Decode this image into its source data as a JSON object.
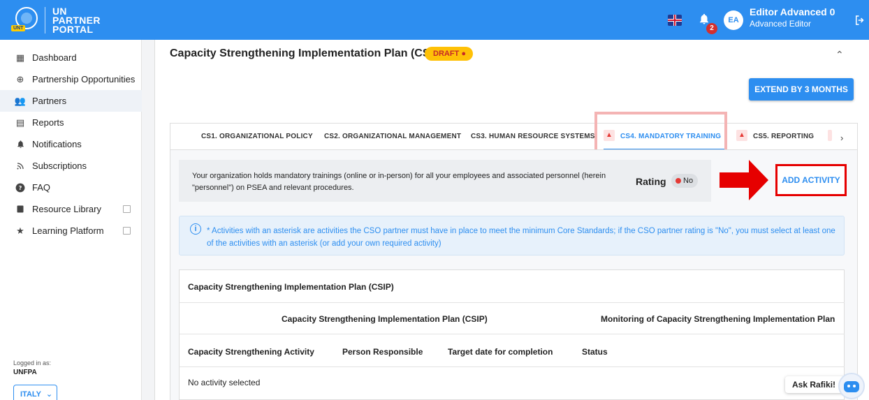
{
  "header": {
    "logo_lines": [
      "UN",
      "PARTNER",
      "PORTAL"
    ],
    "logo_tag": "UNT",
    "notification_count": "2",
    "avatar_initials": "EA",
    "user_name": "Editor Advanced 0",
    "user_role": "Advanced Editor"
  },
  "sidebar": {
    "items": [
      {
        "label": "Dashboard",
        "icon": "dashboard-icon"
      },
      {
        "label": "Partnership Opportunities",
        "icon": "globe-icon"
      },
      {
        "label": "Partners",
        "icon": "people-icon"
      },
      {
        "label": "Reports",
        "icon": "report-icon"
      },
      {
        "label": "Notifications",
        "icon": "bell-icon"
      },
      {
        "label": "Subscriptions",
        "icon": "rss-icon"
      },
      {
        "label": "FAQ",
        "icon": "help-icon"
      },
      {
        "label": "Resource Library",
        "icon": "book-icon"
      },
      {
        "label": "Learning Platform",
        "icon": "star-icon"
      }
    ],
    "active_item": "Partners",
    "logged_in_label": "Logged in as:",
    "org": "UNFPA",
    "country": "ITALY"
  },
  "main": {
    "title": "Capacity Strengthening Implementation Plan (CSIP)",
    "status_badge": "DRAFT",
    "extend_button": "EXTEND BY 3 MONTHS",
    "tabs": [
      {
        "label": "CS1. ORGANIZATIONAL POLICY",
        "warning": false
      },
      {
        "label": "CS2. ORGANIZATIONAL MANAGEMENT",
        "warning": false
      },
      {
        "label": "CS3. HUMAN RESOURCE SYSTEMS",
        "warning": false
      },
      {
        "label": "CS4. MANDATORY TRAINING",
        "warning": true
      },
      {
        "label": "CS5. REPORTING",
        "warning": true
      }
    ],
    "active_tab": "CS4. MANDATORY TRAINING",
    "question": "Your organization holds mandatory trainings (online or in-person) for all your employees and associated personnel (herein \"personnel\") on PSEA and relevant procedures.",
    "rating_label": "Rating",
    "rating_value": "No",
    "add_activity_button": "ADD ACTIVITY",
    "info_text": "* Activities with an asterisk are activities the CSO partner must have in place to meet the minimum Core Standards; if the CSO partner rating is \"No\", you must select at least one of the activities with an asterisk (or add your own required activity)",
    "table": {
      "title": "Capacity Strengthening Implementation Plan (CSIP)",
      "group_headers": [
        "Capacity Strengthening Implementation Plan (CSIP)",
        "Monitoring of Capacity Strengthening Implementation Plan"
      ],
      "columns": [
        "Capacity Strengthening Activity",
        "Person Responsible",
        "Target date for completion",
        "Status"
      ],
      "empty_message": "No activity selected"
    }
  },
  "assistant": {
    "label": "Ask Rafiki!"
  },
  "colors": {
    "primary": "#2d8ef0",
    "draft": "#ffc107",
    "danger": "#e53935"
  }
}
